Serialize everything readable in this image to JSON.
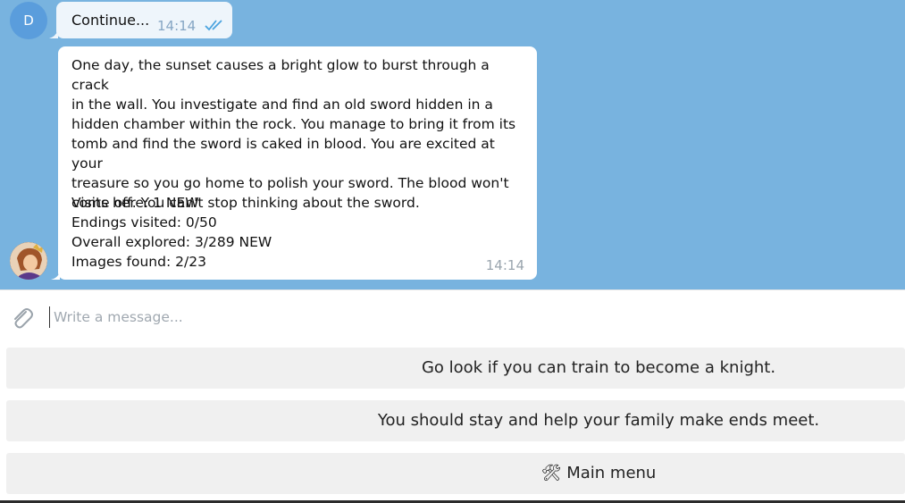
{
  "colors": {
    "chat_background": "#78b3df",
    "outgoing_bubble": "#eef5fb",
    "incoming_bubble": "#ffffff",
    "read_ticks": "#4aa3df",
    "keyboard_button": "#f0f0f0"
  },
  "outgoing_message": {
    "avatar_letter": "D",
    "text": "Continue...",
    "time": "14:14",
    "status_icon": "double-check-icon"
  },
  "incoming_message": {
    "story": "One day, the sunset causes a bright glow to burst through a crack\nin the wall. You investigate and find an old sword hidden in a\nhidden chamber within the rock. You manage to bring it from its\ntomb and find the sword is caked in blood. You are excited at your\ntreasure so you go home to polish your sword. The blood won't\ncome off. You can't stop thinking about the sword.",
    "stats": [
      "Visits here: 1 NEW",
      "Endings visited: 0/50",
      "Overall explored: 3/289 NEW",
      "Images found: 2/23"
    ],
    "time": "14:14"
  },
  "composer": {
    "placeholder": "Write a message...",
    "attach_icon": "paperclip-icon"
  },
  "keyboard": {
    "buttons": [
      "Go look if you can train to become a knight.",
      "You should stay and help your family make ends meet.",
      "🛠 Main menu"
    ]
  }
}
